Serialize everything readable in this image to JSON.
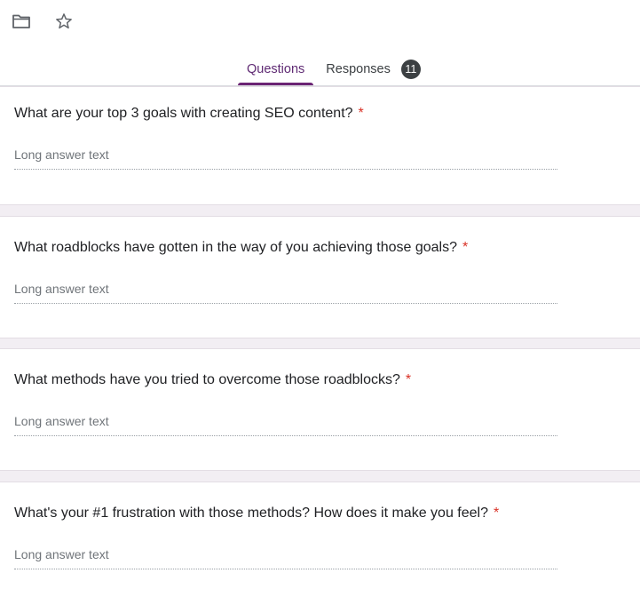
{
  "toolbar": {
    "folder_icon": "folder-icon",
    "star_icon": "star-icon"
  },
  "tabs": {
    "questions_label": "Questions",
    "responses_label": "Responses",
    "responses_count": "11"
  },
  "questions": [
    {
      "text": "What are your top 3 goals with creating SEO content?",
      "required_mark": "*",
      "placeholder": "Long answer text"
    },
    {
      "text": "What roadblocks have gotten in the way of you achieving those goals?",
      "required_mark": "*",
      "placeholder": "Long answer text"
    },
    {
      "text": "What methods have you tried to overcome those roadblocks?",
      "required_mark": "*",
      "placeholder": "Long answer text"
    },
    {
      "text": "What's your #1 frustration with those methods? How does it make you feel?",
      "required_mark": "*",
      "placeholder": "Long answer text"
    }
  ],
  "colors": {
    "accent": "#6b2474",
    "required": "#d93025",
    "page_background": "#f2eef3"
  }
}
